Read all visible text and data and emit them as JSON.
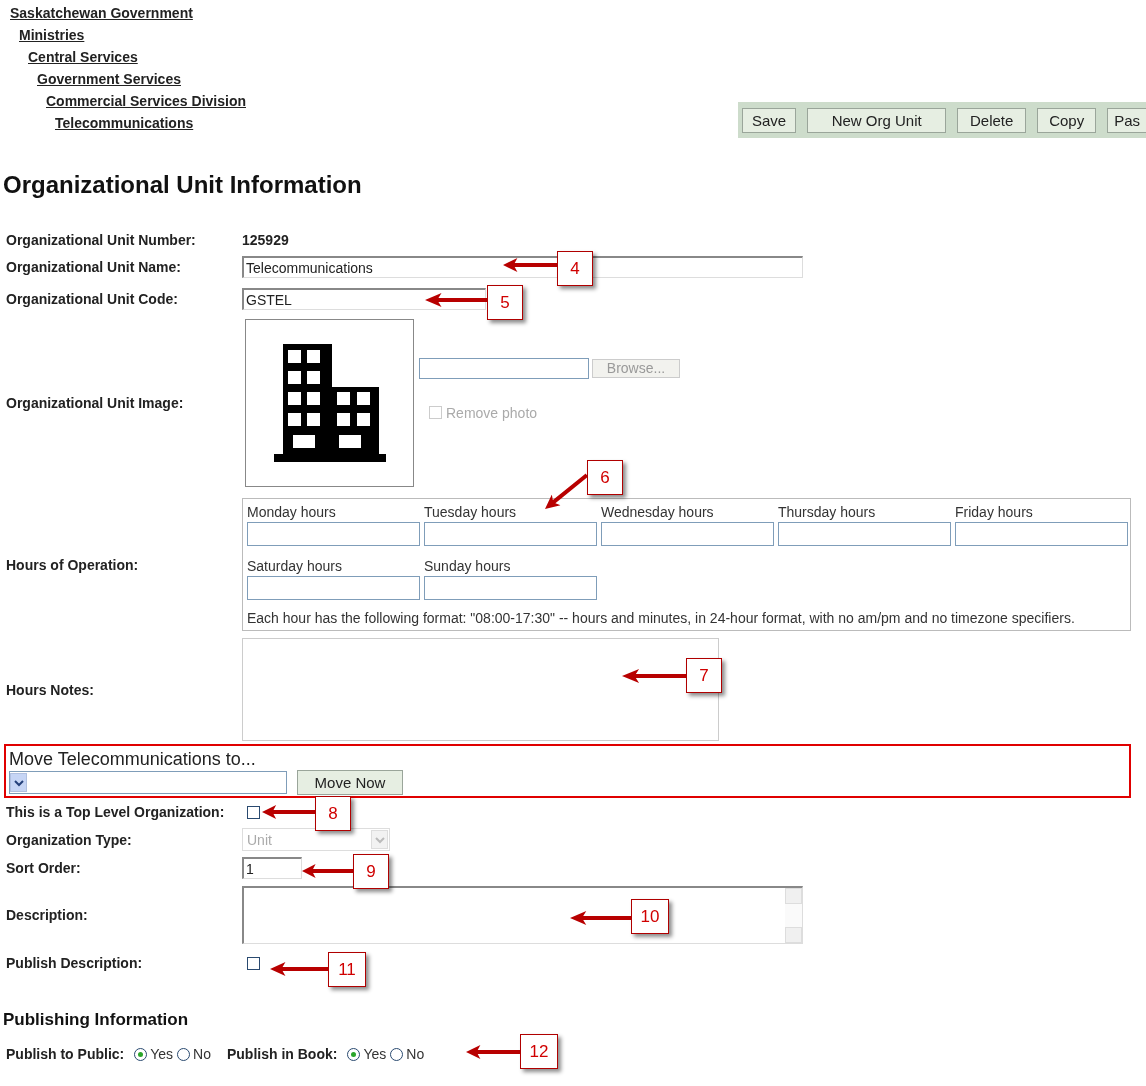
{
  "breadcrumb": [
    {
      "label": "Saskatchewan Government",
      "children": [
        {
          "label": "Ministries",
          "children": [
            {
              "label": "Central Services",
              "children": [
                {
                  "label": "Government Services",
                  "children": [
                    {
                      "label": "Commercial Services Division",
                      "children": [
                        {
                          "label": "Telecommunications"
                        }
                      ]
                    }
                  ]
                }
              ]
            }
          ]
        }
      ]
    }
  ],
  "toolbar": {
    "buttons": [
      "Save",
      "New Org Unit",
      "Delete",
      "Copy",
      "Pas"
    ]
  },
  "title": "Organizational Unit Information",
  "form": {
    "unit_number": {
      "label": "Organizational Unit Number:",
      "value": "125929"
    },
    "unit_name": {
      "label": "Organizational Unit Name:",
      "value": "Telecommunications"
    },
    "unit_code": {
      "label": "Organizational Unit Code:",
      "value": "GSTEL"
    },
    "unit_image": {
      "label": "Organizational Unit Image:",
      "browse_button": "Browse...",
      "remove_photo": {
        "label": "Remove photo",
        "checked": false,
        "disabled": true
      }
    },
    "hours": {
      "label": "Hours of Operation:",
      "days": [
        "Monday hours",
        "Tuesday hours",
        "Wednesday hours",
        "Thursday hours",
        "Friday hours",
        "Saturday hours",
        "Sunday hours"
      ],
      "note": "Each hour has the following format: \"08:00-17:30\" -- hours and minutes, in 24-hour format, with no am/pm and no timezone specifiers."
    },
    "hours_notes": {
      "label": "Hours Notes:"
    },
    "move": {
      "title": "Move Telecommunications to...",
      "button": "Move Now"
    },
    "top_level": {
      "label": "This is a Top Level Organization:",
      "checked": false
    },
    "org_type": {
      "label": "Organization Type:",
      "value": "Unit",
      "disabled": true
    },
    "sort_order": {
      "label": "Sort Order:",
      "value": "1"
    },
    "description": {
      "label": "Description:"
    },
    "publish_description": {
      "label": "Publish Description:",
      "checked": false
    }
  },
  "publishing": {
    "title": "Publishing Information",
    "options": [
      {
        "label": "Publish to Public:",
        "choices": [
          {
            "label": "Yes",
            "selected": true
          },
          {
            "label": "No",
            "selected": false
          }
        ]
      },
      {
        "label": "Publish in Book:",
        "choices": [
          {
            "label": "Yes",
            "selected": true
          },
          {
            "label": "No",
            "selected": false
          }
        ]
      }
    ]
  },
  "callouts": [
    "4",
    "5",
    "6",
    "7",
    "8",
    "9",
    "10",
    "11",
    "12"
  ]
}
